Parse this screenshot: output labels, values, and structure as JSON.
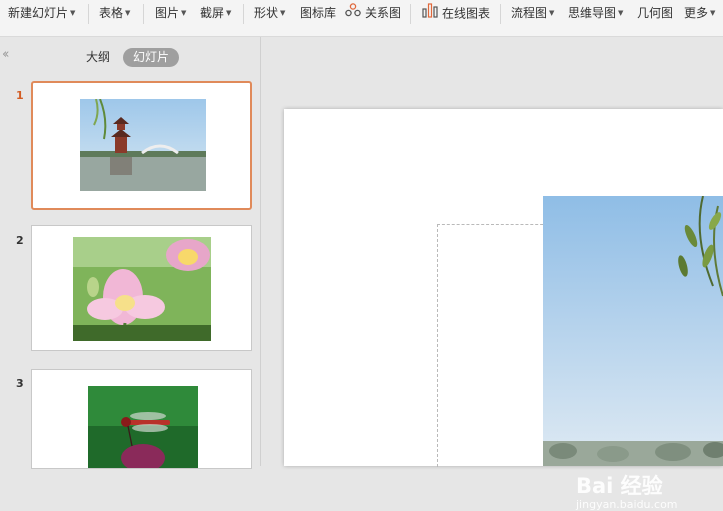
{
  "toolbar": {
    "new_slide": "新建幻灯片",
    "table": "表格",
    "picture": "图片",
    "screenshot": "截屏",
    "shape": "形状",
    "icon_lib": "图标库",
    "relation": "关系图",
    "online_chart": "在线图表",
    "flowchart": "流程图",
    "mindmap": "思维导图",
    "geometry": "几何图",
    "more": "更多"
  },
  "left_panel": {
    "tab_outline": "大纲",
    "tab_slides": "幻灯片",
    "slides": [
      {
        "number": "1",
        "image": "pagoda-lake-photo"
      },
      {
        "number": "2",
        "image": "lotus-flower-photo"
      },
      {
        "number": "3",
        "image": "dragonfly-photo"
      }
    ]
  },
  "watermark": {
    "logo": "Bai 经验",
    "url": "jingyan.baidu.com"
  },
  "colors": {
    "accent": "#d35d24",
    "selected_border": "#e08a5a",
    "panel_bg": "#e6e6e6",
    "tab_active_bg": "#9f9f9f"
  }
}
